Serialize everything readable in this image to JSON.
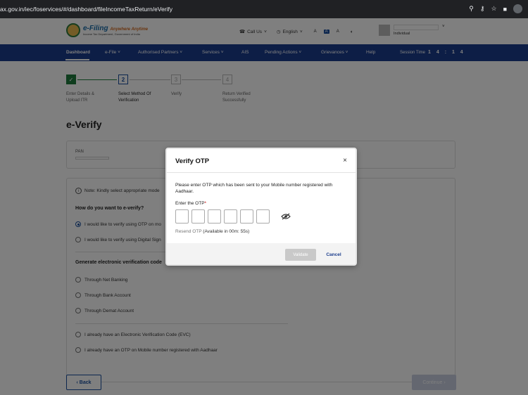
{
  "browser": {
    "url": "ax.gov.in/iec/foservices/#/dashboard/fileIncomeTaxReturn/eVerify"
  },
  "header": {
    "logo_title": "e-Filing",
    "logo_tagline": "Anywhere Anytime",
    "logo_sub": "Income Tax Department, Government of India",
    "call_us": "Call Us",
    "language": "English",
    "font_small": "A",
    "font_default": "A",
    "font_large": "A",
    "user_role": "Individual"
  },
  "nav": {
    "items": [
      "Dashboard",
      "e-File",
      "Authorised Partners",
      "Services",
      "AIS",
      "Pending Actions",
      "Grievances",
      "Help"
    ],
    "session_label": "Session Time",
    "session_value": "1 4 : 1 4"
  },
  "stepper": {
    "steps": [
      {
        "num": "✓",
        "label": "Enter Details & Upload ITR"
      },
      {
        "num": "2",
        "label": "Select Method Of Verification"
      },
      {
        "num": "3",
        "label": "Verify"
      },
      {
        "num": "4",
        "label": "Return Verified Successfully"
      }
    ]
  },
  "page": {
    "title": "e-Verify",
    "pan_label": "PAN",
    "note": "Note: Kindly select appropriate mode",
    "question": "How do you want to e-verify?",
    "options": [
      "I would like to verify using OTP on mo",
      "I would like to verify using Digital Sign"
    ],
    "evc_heading": "Generate electronic verification code",
    "evc_options": [
      "Through Net Banking",
      "Through Bank Account",
      "Through Demat Account"
    ],
    "other_options": [
      "I already have an Electronic Verification Code (EVC)",
      "I already have an OTP on Mobile number registered with Aadhaar"
    ],
    "back_label": "Back",
    "continue_label": "Continue"
  },
  "modal": {
    "title": "Verify OTP",
    "close": "×",
    "message": "Please enter OTP which has been sent to your Mobile number registered with Aadhaar.",
    "otp_label": "Enter the OTP",
    "required_mark": "*",
    "resend_link": "Resend OTP",
    "resend_timer": "(Available in  00m: 55s)",
    "validate_label": "Validate",
    "cancel_label": "Cancel"
  }
}
